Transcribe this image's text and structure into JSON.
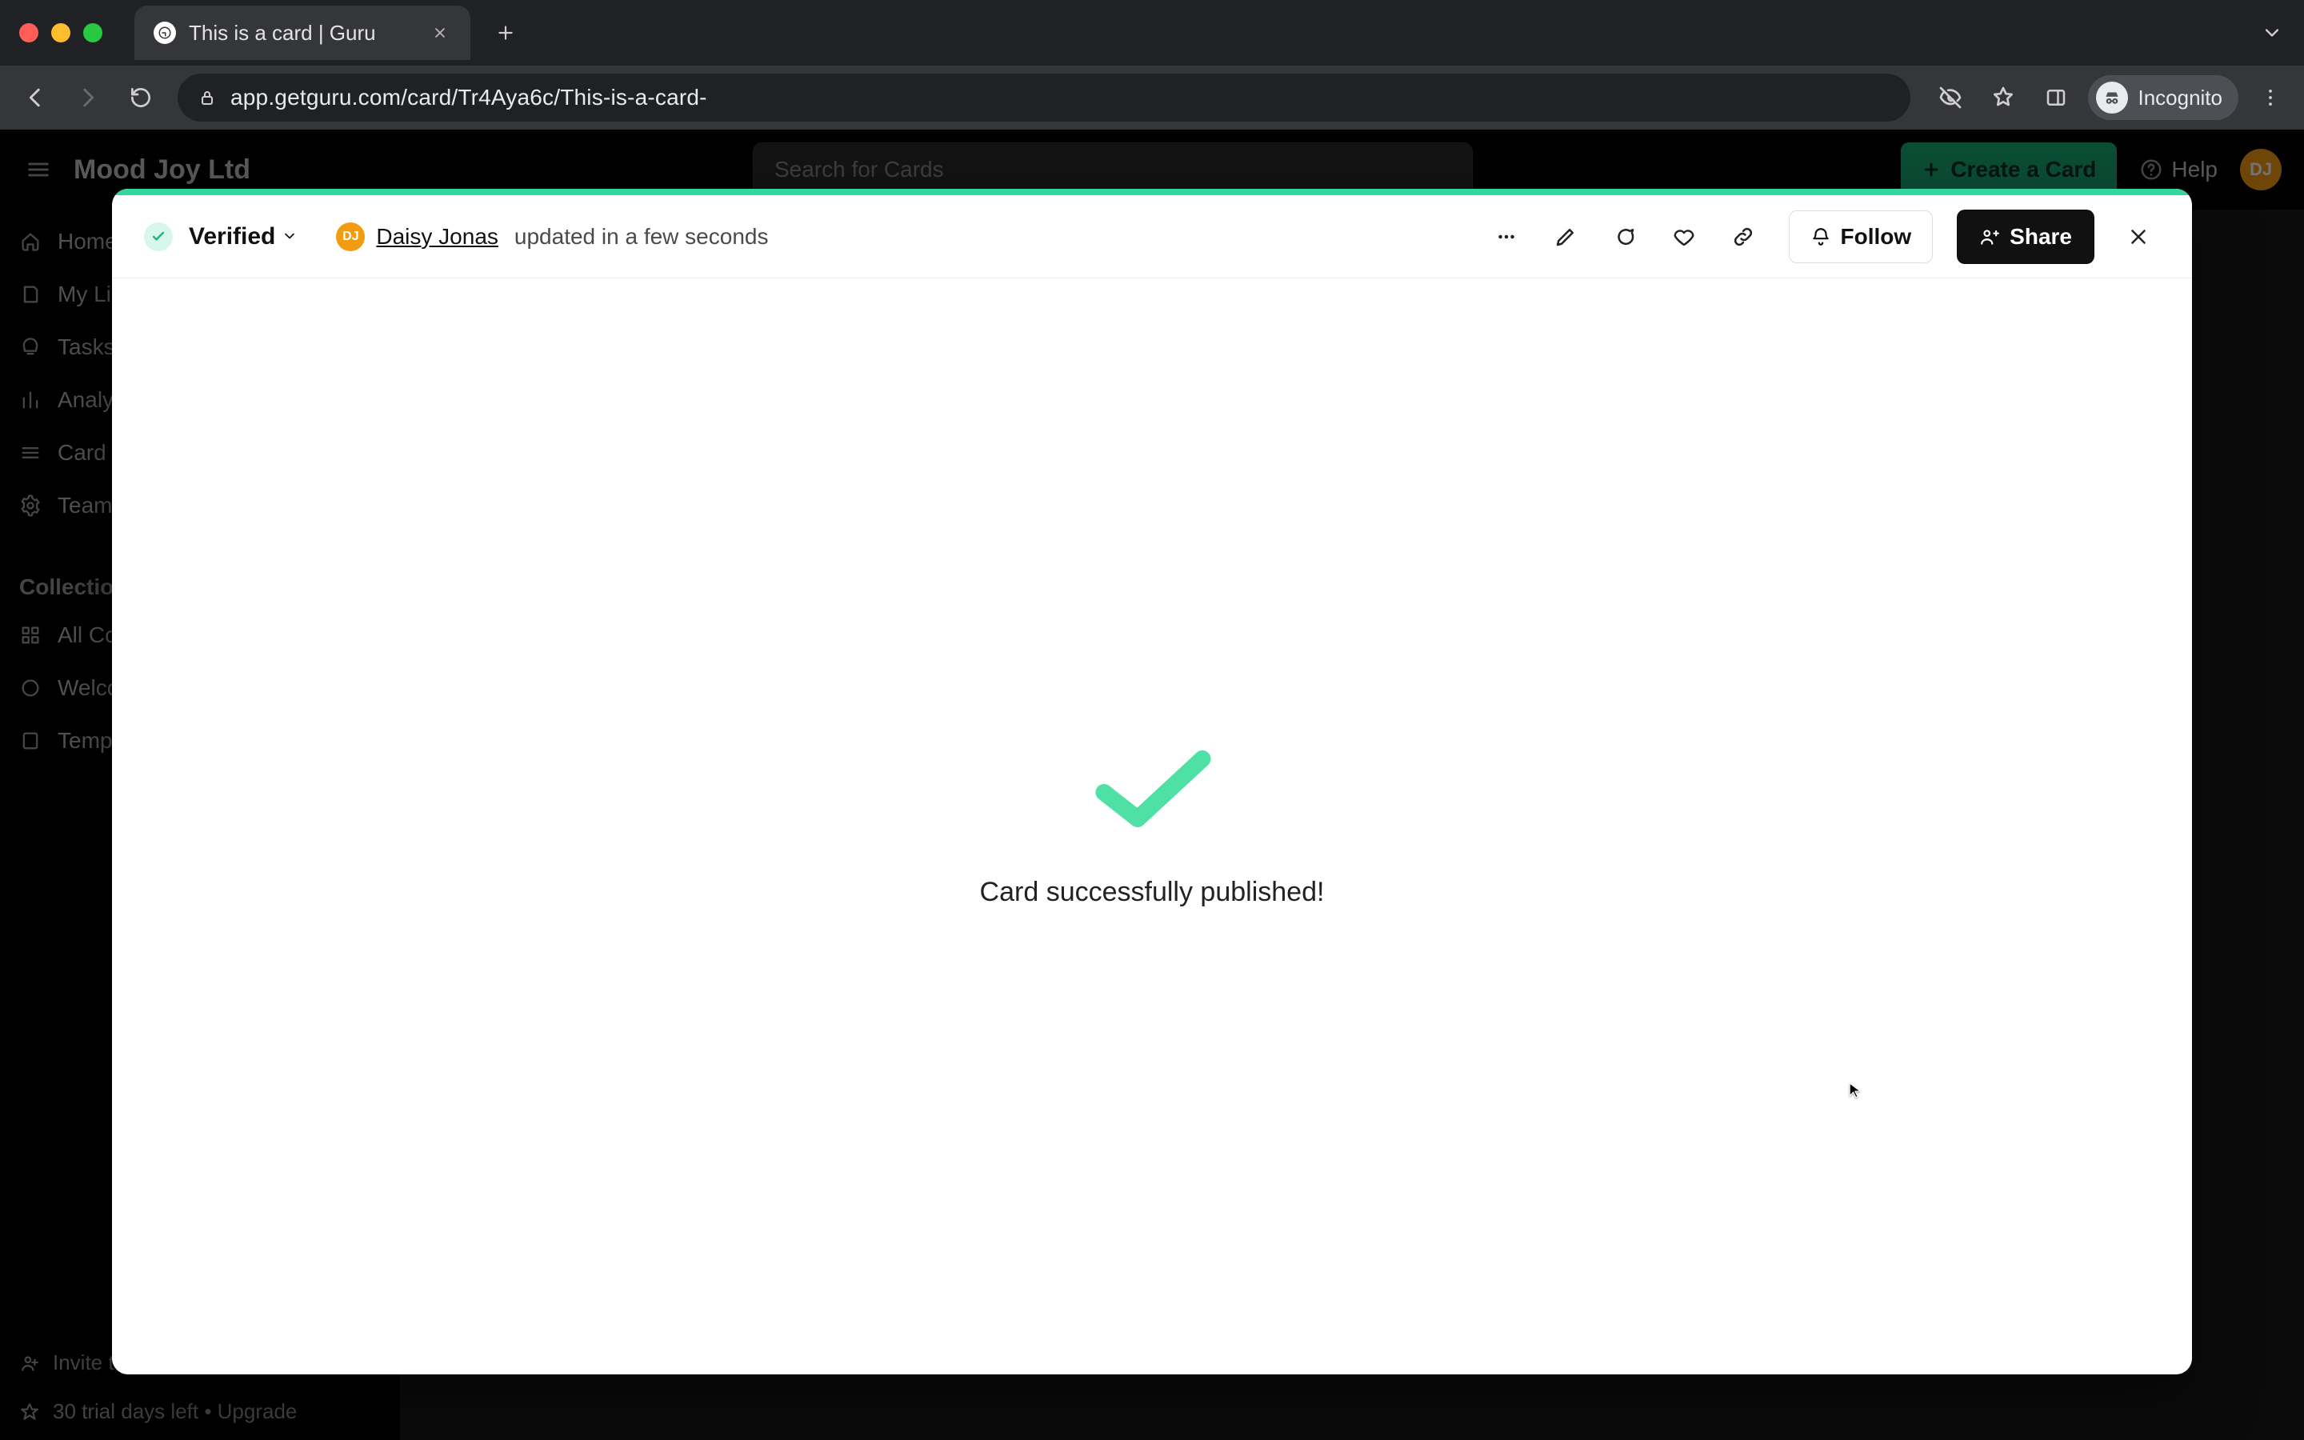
{
  "browser": {
    "tab_title": "This is a card | Guru",
    "url": "app.getguru.com/card/Tr4Aya6c/This-is-a-card-",
    "incognito_label": "Incognito"
  },
  "app_header": {
    "workspace": "Mood Joy Ltd",
    "search_placeholder": "Search for Cards",
    "create_label": "Create a Card",
    "help_label": "Help",
    "user_initials": "DJ"
  },
  "sidebar": {
    "nav": [
      {
        "label": "Home"
      },
      {
        "label": "My Library"
      },
      {
        "label": "Tasks"
      },
      {
        "label": "Analytics"
      },
      {
        "label": "Card Manager"
      },
      {
        "label": "Team Settings"
      }
    ],
    "section": "Collections",
    "collections": [
      {
        "label": "All Collections"
      },
      {
        "label": "Welcome to Guru"
      },
      {
        "label": "Templates"
      }
    ],
    "invite_label": "Invite teammates",
    "trial_label": "30 trial days left • Upgrade"
  },
  "card": {
    "verified_label": "Verified",
    "author_initials": "DJ",
    "author_name": "Daisy Jonas",
    "updated_text": "updated in a few seconds",
    "follow_label": "Follow",
    "share_label": "Share",
    "success_message": "Card successfully published!"
  },
  "colors": {
    "brand_green": "#33d69f",
    "avatar_orange": "#f39c12"
  }
}
